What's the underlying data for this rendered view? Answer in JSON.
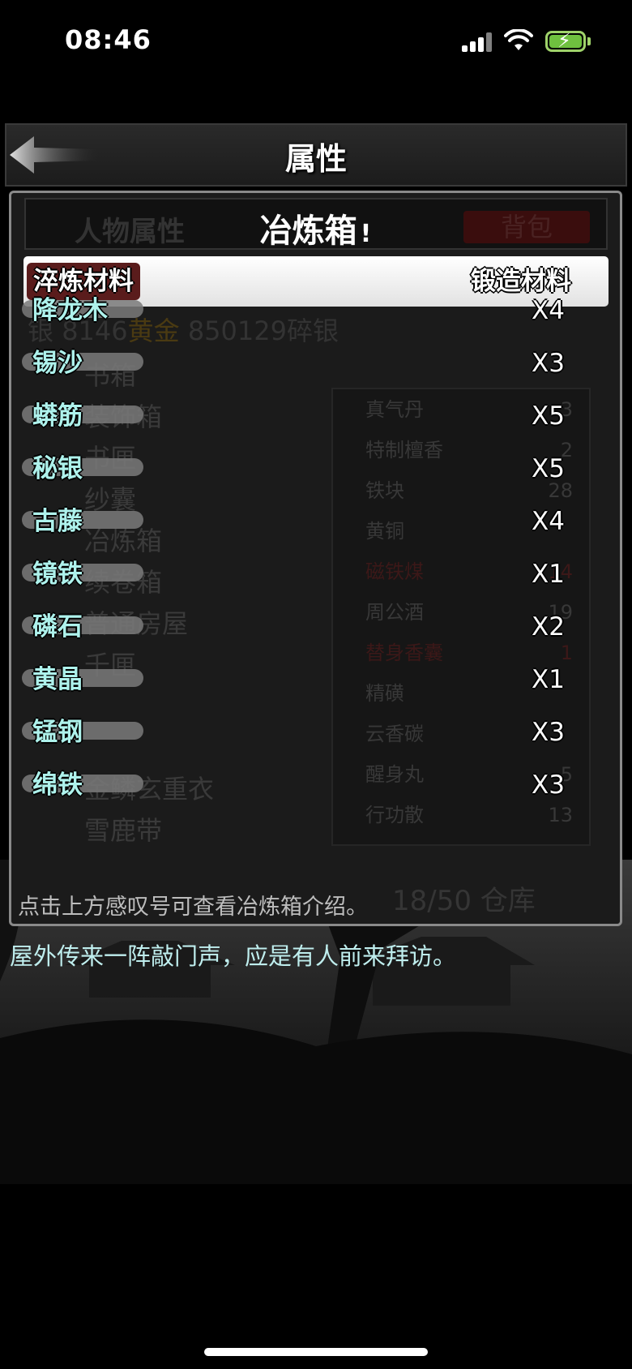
{
  "status_bar": {
    "time": "08:46",
    "battery_color": "#6fc03f"
  },
  "header": {
    "title": "属性",
    "back_icon": "back-arrow-icon"
  },
  "background_page": {
    "tab_character": "人物属性",
    "tab_bag": "背包",
    "money_prefix": "银",
    "money_mid": "8146",
    "gold_label": "黄金",
    "money_silver": "850129碎银",
    "boxes": [
      "书箱",
      "装饰箱",
      "书匣",
      "纱囊",
      "冶炼箱",
      "续卷箱",
      "普通房屋",
      "千匣",
      "",
      "",
      "金鳞玄重衣",
      "雪鹿带"
    ],
    "items": [
      {
        "name": "真气丹",
        "count": "3"
      },
      {
        "name": "特制檀香",
        "count": "2"
      },
      {
        "name": "铁块",
        "count": "28"
      },
      {
        "name": "黄铜",
        "count": ""
      },
      {
        "name": "磁铁煤",
        "count": "14"
      },
      {
        "name": "周公酒",
        "count": "19"
      },
      {
        "name": "替身香囊",
        "count": "1"
      },
      {
        "name": "精磺",
        "count": ""
      },
      {
        "name": "云香碳",
        "count": ""
      },
      {
        "name": "醒身丸",
        "count": "5"
      },
      {
        "name": "行功散",
        "count": "13"
      }
    ],
    "capacity": "18/50 仓库"
  },
  "dialog": {
    "title": "冶炼箱",
    "info_mark": "!",
    "tabs": {
      "refine": "淬炼材料",
      "forge": "锻造材料"
    },
    "materials": [
      {
        "name": "降龙木",
        "count": "X4"
      },
      {
        "name": "锡沙",
        "count": "X3"
      },
      {
        "name": "蟒筋",
        "count": "X5"
      },
      {
        "name": "秘银",
        "count": "X5"
      },
      {
        "name": "古藤",
        "count": "X4"
      },
      {
        "name": "镜铁",
        "count": "X1"
      },
      {
        "name": "磷石",
        "count": "X2"
      },
      {
        "name": "黄晶",
        "count": "X1"
      },
      {
        "name": "锰钢",
        "count": "X3"
      },
      {
        "name": "绵铁",
        "count": "X3"
      }
    ],
    "hint": "点击上方感叹号可查看冶炼箱介绍。"
  },
  "notice": "屋外传来一阵敲门声，应是有人前来拜访。"
}
